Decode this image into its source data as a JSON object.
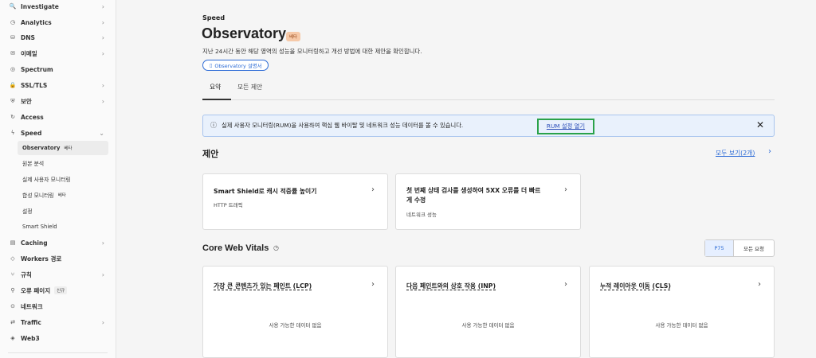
{
  "sidebar": {
    "items": [
      {
        "icon": "🔍",
        "label": "Investigate",
        "chevron": true
      },
      {
        "icon": "◷",
        "label": "Analytics",
        "chevron": true
      },
      {
        "icon": "⛁",
        "label": "DNS",
        "chevron": true
      },
      {
        "icon": "✉",
        "label": "이메일",
        "chevron": true
      },
      {
        "icon": "◎",
        "label": "Spectrum",
        "chevron": false
      },
      {
        "icon": "🔒",
        "label": "SSL/TLS",
        "chevron": true
      },
      {
        "icon": "⛨",
        "label": "보안",
        "chevron": true
      },
      {
        "icon": "↻",
        "label": "Access",
        "chevron": false
      },
      {
        "icon": "ϟ",
        "label": "Speed",
        "chevron": true
      }
    ],
    "speed_sub": [
      {
        "label": "Observatory",
        "badge": "베타"
      },
      {
        "label": "원본 분석",
        "badge": ""
      },
      {
        "label": "실제 사용자 모니터링",
        "badge": ""
      },
      {
        "label": "합성 모니터링",
        "badge": "베타"
      },
      {
        "label": "설정",
        "badge": ""
      },
      {
        "label": "Smart Shield",
        "badge": ""
      }
    ],
    "items_after": [
      {
        "icon": "▤",
        "label": "Caching",
        "chevron": true,
        "tag": ""
      },
      {
        "icon": "◇",
        "label": "Workers 경로",
        "chevron": false,
        "tag": ""
      },
      {
        "icon": "⑂",
        "label": "규칙",
        "chevron": true,
        "tag": ""
      },
      {
        "icon": "⚲",
        "label": "오류 페이지",
        "chevron": false,
        "tag": "신규"
      },
      {
        "icon": "⊙",
        "label": "네트워크",
        "chevron": false,
        "tag": ""
      },
      {
        "icon": "⇄",
        "label": "Traffic",
        "chevron": true,
        "tag": ""
      },
      {
        "icon": "◈",
        "label": "Web3",
        "chevron": false,
        "tag": ""
      }
    ]
  },
  "header": {
    "breadcrumb": "Speed",
    "title": "Observatory",
    "badge": "베타",
    "description": "지난 24시간 동안 해당 영역의 성능을 모니터링하고 개선 방법에 대한 제안을 확인합니다.",
    "doc_button": "Observatory 설명서"
  },
  "tabs": [
    "요약",
    "모든 제안"
  ],
  "banner": {
    "message": "실제 사용자 모니터링(RUM)을 사용하여 핵심 웹 바이탈 및 네트워크 성능 데이터를 볼 수 있습니다.",
    "link": "RUM 설정 열기"
  },
  "suggestions": {
    "heading": "제안",
    "see_all": "모두 보기(2개)",
    "cards": [
      {
        "title": "Smart Shield로 캐시 적중률 높이기",
        "subtitle": "HTTP 트래픽"
      },
      {
        "title": "첫 번째 상태 검사를 생성하여 5XX 오류를 더 빠르게 수정",
        "subtitle": "네트워크 성능"
      }
    ]
  },
  "cwv": {
    "heading": "Core Web Vitals",
    "toggle": [
      "P75",
      "모든 요청"
    ],
    "cards": [
      {
        "title": "가장 큰 콘텐츠가 있는 페인트 (LCP)",
        "empty": "사용 가능한 데이터 없음"
      },
      {
        "title": "다음 페인트와의 상호 작용 (INP)",
        "empty": "사용 가능한 데이터 없음"
      },
      {
        "title": "누적 레이아웃 이동 (CLS)",
        "empty": "사용 가능한 데이터 없음"
      }
    ]
  },
  "colors": {
    "accent": "#2c6bd6",
    "banner_bg": "#e9f1fc",
    "highlight": "#2aa24a",
    "badge_bg": "#f6c9a8"
  }
}
